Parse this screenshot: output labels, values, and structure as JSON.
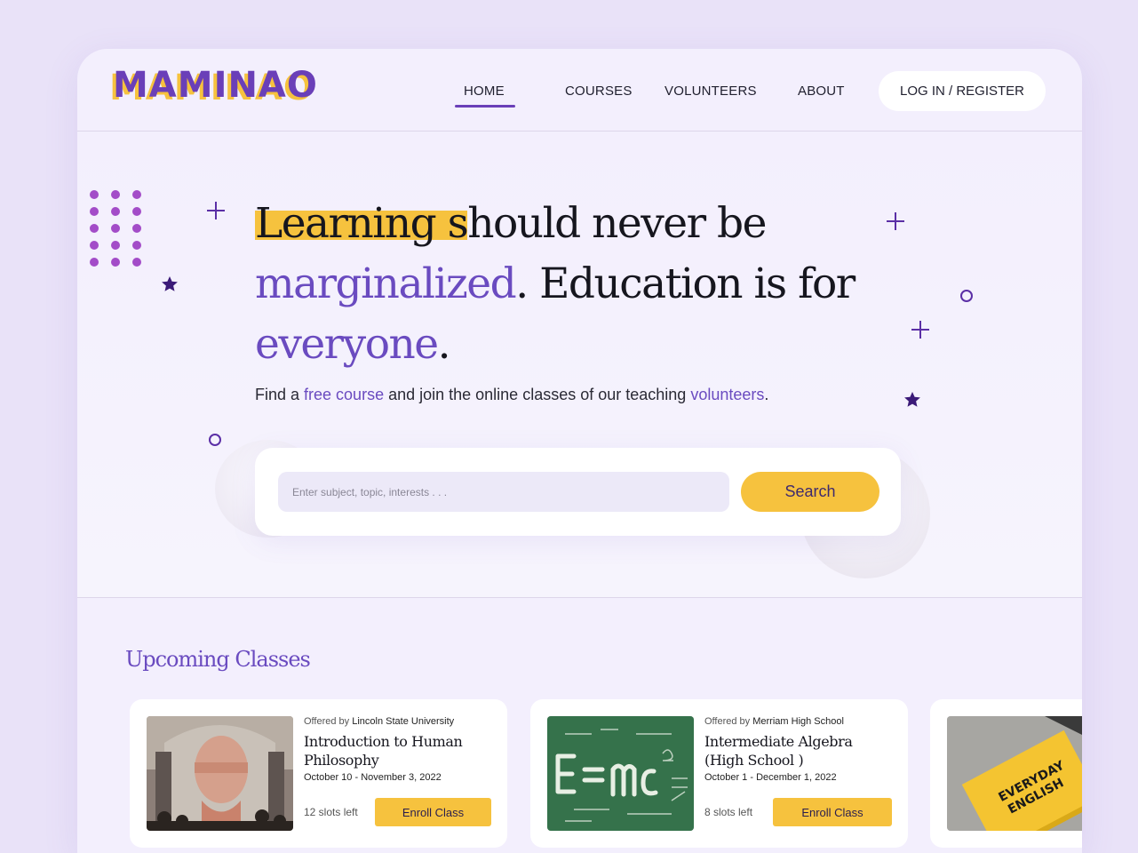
{
  "brand": {
    "logo_text": "MAMINAO",
    "logo_color": "#6a3fb8",
    "logo_shadow_color": "#f6c23e"
  },
  "nav": {
    "items": [
      {
        "label": "HOME",
        "active": true
      },
      {
        "label": "COURSES"
      },
      {
        "label": "VOLUNTEERS"
      },
      {
        "label": "ABOUT"
      }
    ],
    "login_label": "LOG IN / REGISTER"
  },
  "hero": {
    "headline": {
      "part1_highlight": "Learning s",
      "part1_rest": "hould never be",
      "part2_purple": "marginalized",
      "part2_rest": ". Education is for",
      "part3_purple": "everyone",
      "part3_end": "."
    },
    "subline": {
      "prefix": "Find a ",
      "link1": "free course",
      "middle": " and join the online classes of our teaching ",
      "link2": "volunteers",
      "suffix": "."
    },
    "search": {
      "placeholder": "Enter subject, topic, interests . . .",
      "button_label": "Search"
    }
  },
  "upcoming": {
    "title": "Upcoming Classes",
    "cards": [
      {
        "offered_prefix": "Offered by",
        "offered_by": "Lincoln State University",
        "title": "Introduction to Human Philosophy",
        "dates": "October 10 - November 3, 2022",
        "slots": "12 slots left",
        "enroll_label": "Enroll Class"
      },
      {
        "offered_prefix": "Offered by",
        "offered_by": "Merriam High School",
        "title": "Intermediate Algebra (High School )",
        "dates": "October 1 - December 1, 2022",
        "slots": "8 slots left",
        "enroll_label": "Enroll Class"
      },
      {
        "book_text_1": "EVERYDAY",
        "book_text_2": "ENGLISH"
      }
    ]
  },
  "colors": {
    "accent_purple": "#6a4bc0",
    "accent_yellow": "#f6c23e",
    "background": "#e9e2f8"
  }
}
